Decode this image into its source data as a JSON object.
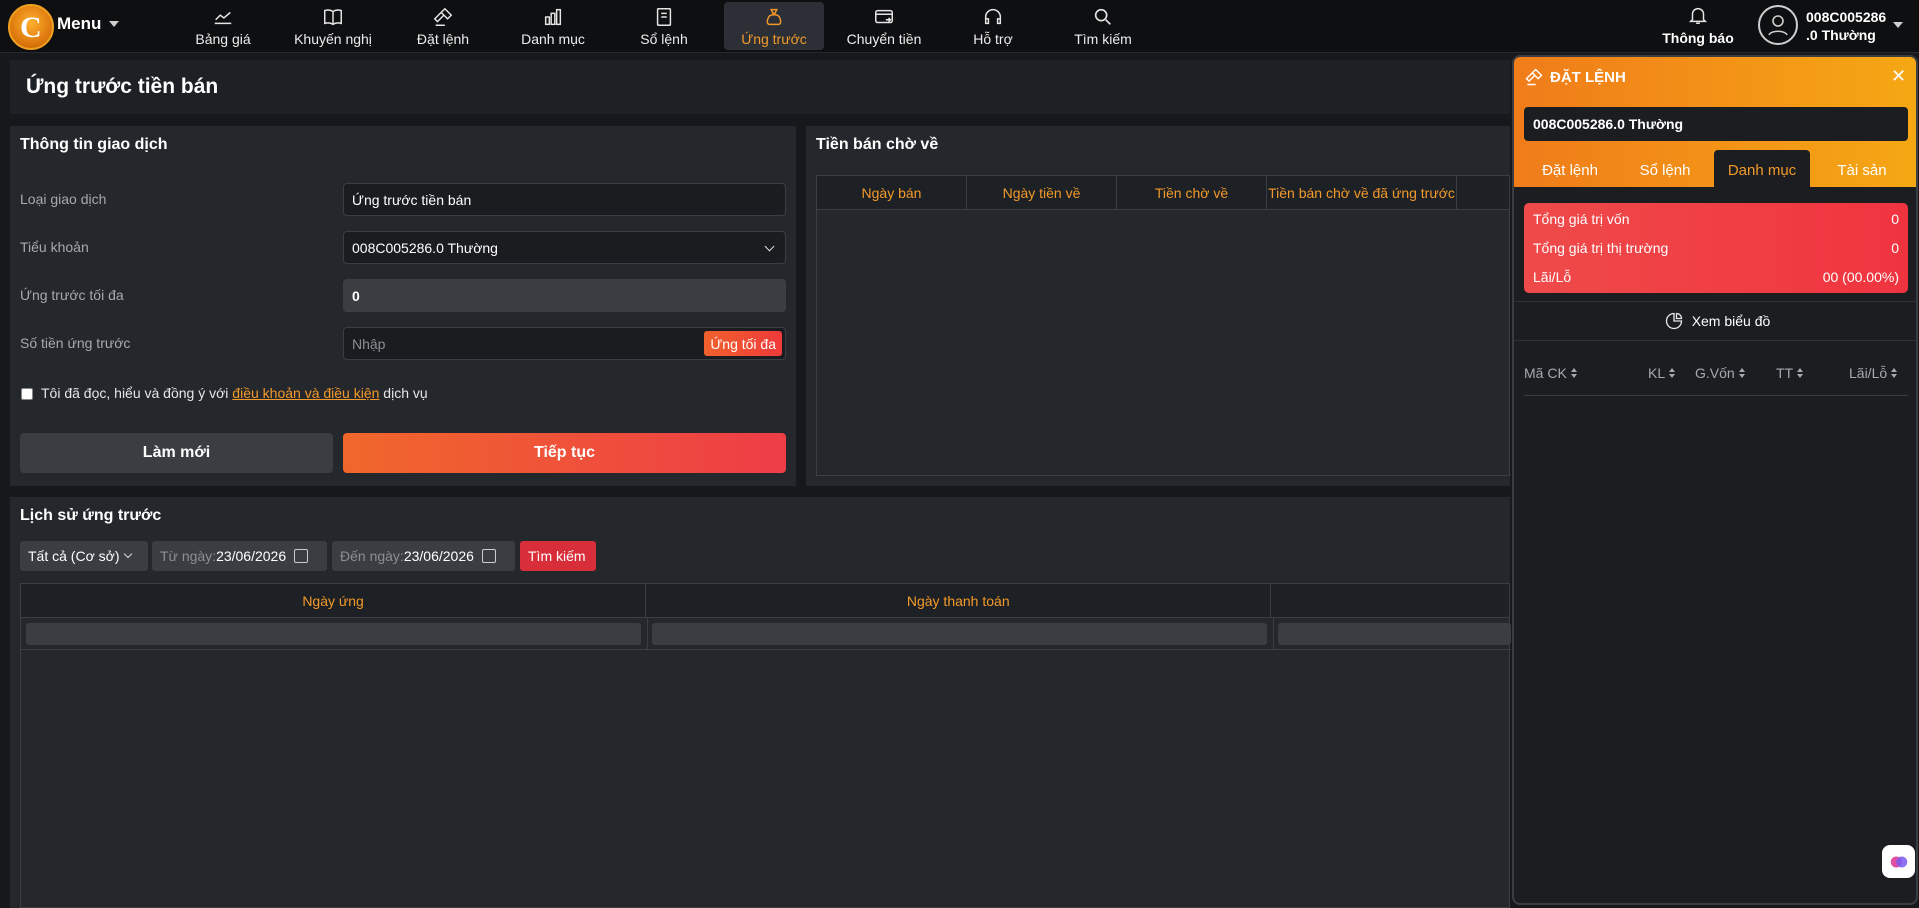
{
  "topbar": {
    "menu_label": "Menu",
    "nav": [
      {
        "label": "Bảng giá",
        "icon": "chart-area-icon"
      },
      {
        "label": "Khuyến nghị",
        "icon": "book-open-icon"
      },
      {
        "label": "Đặt lệnh",
        "icon": "gavel-icon"
      },
      {
        "label": "Danh mục",
        "icon": "bar-chart-icon"
      },
      {
        "label": "Sổ lệnh",
        "icon": "notebook-icon"
      },
      {
        "label": "Ứng trước",
        "icon": "money-bag-icon",
        "active": true
      },
      {
        "label": "Chuyển tiền",
        "icon": "card-transfer-icon"
      },
      {
        "label": "Hỗ trợ",
        "icon": "headset-icon"
      },
      {
        "label": "Tìm kiếm",
        "icon": "search-icon"
      }
    ],
    "notify_label": "Thông báo",
    "account_line1": "008C005286",
    "account_line2": ".0 Thường"
  },
  "page": {
    "title": "Ứng trước tiền bán"
  },
  "transaction": {
    "title": "Thông tin giao dịch",
    "type_label": "Loại giao dịch",
    "type_value": "Ứng trước tiền bán",
    "subaccount_label": "Tiểu khoản",
    "subaccount_value": "008C005286.0 Thường",
    "max_label": "Ứng trước tối đa",
    "max_value": "0",
    "amount_label": "Số tiền ứng trước",
    "amount_placeholder": "Nhập",
    "max_button": "Ứng tối đa",
    "agree_prefix": "Tôi đã đọc, hiểu và đồng ý với",
    "agree_link": "điều khoản và điều kiện",
    "agree_suffix": "dịch vụ",
    "reset_button": "Làm mới",
    "continue_button": "Tiếp tục"
  },
  "pending": {
    "title": "Tiền bán chờ về",
    "columns": [
      "Ngày bán",
      "Ngày tiền về",
      "Tiền chờ về",
      "Tiền bán chờ về đã ứng trước"
    ]
  },
  "history": {
    "title": "Lịch sử ứng trước",
    "filter_type": "Tất cả (Cơ sở)",
    "from_label": "Từ ngày:",
    "from_value": "23/06/2026",
    "to_label": "Đến ngày:",
    "to_value": "23/06/2026",
    "search_button": "Tìm kiếm",
    "columns": [
      "Ngày ứng",
      "Ngày thanh toán"
    ]
  },
  "panel": {
    "title": "ĐẶT LỆNH",
    "account": "008C005286.0 Thường",
    "tabs": [
      "Đặt lệnh",
      "Sổ lệnh",
      "Danh mục",
      "Tài sản"
    ],
    "active_tab": "Danh mục",
    "summary": [
      {
        "label": "Tổng giá trị vốn",
        "value": "0"
      },
      {
        "label": "Tổng giá trị thị trường",
        "value": "0"
      },
      {
        "label": "Lãi/Lỗ",
        "value": "00 (00.00%)"
      }
    ],
    "chart_link": "Xem biểu đồ",
    "columns": [
      "Mã CK",
      "KL",
      "G.Vốn",
      "TT",
      "Lãi/Lỗ"
    ]
  },
  "colors": {
    "accent": "#f39a2a",
    "danger": "#ef3a3a",
    "background": "#16181c"
  }
}
